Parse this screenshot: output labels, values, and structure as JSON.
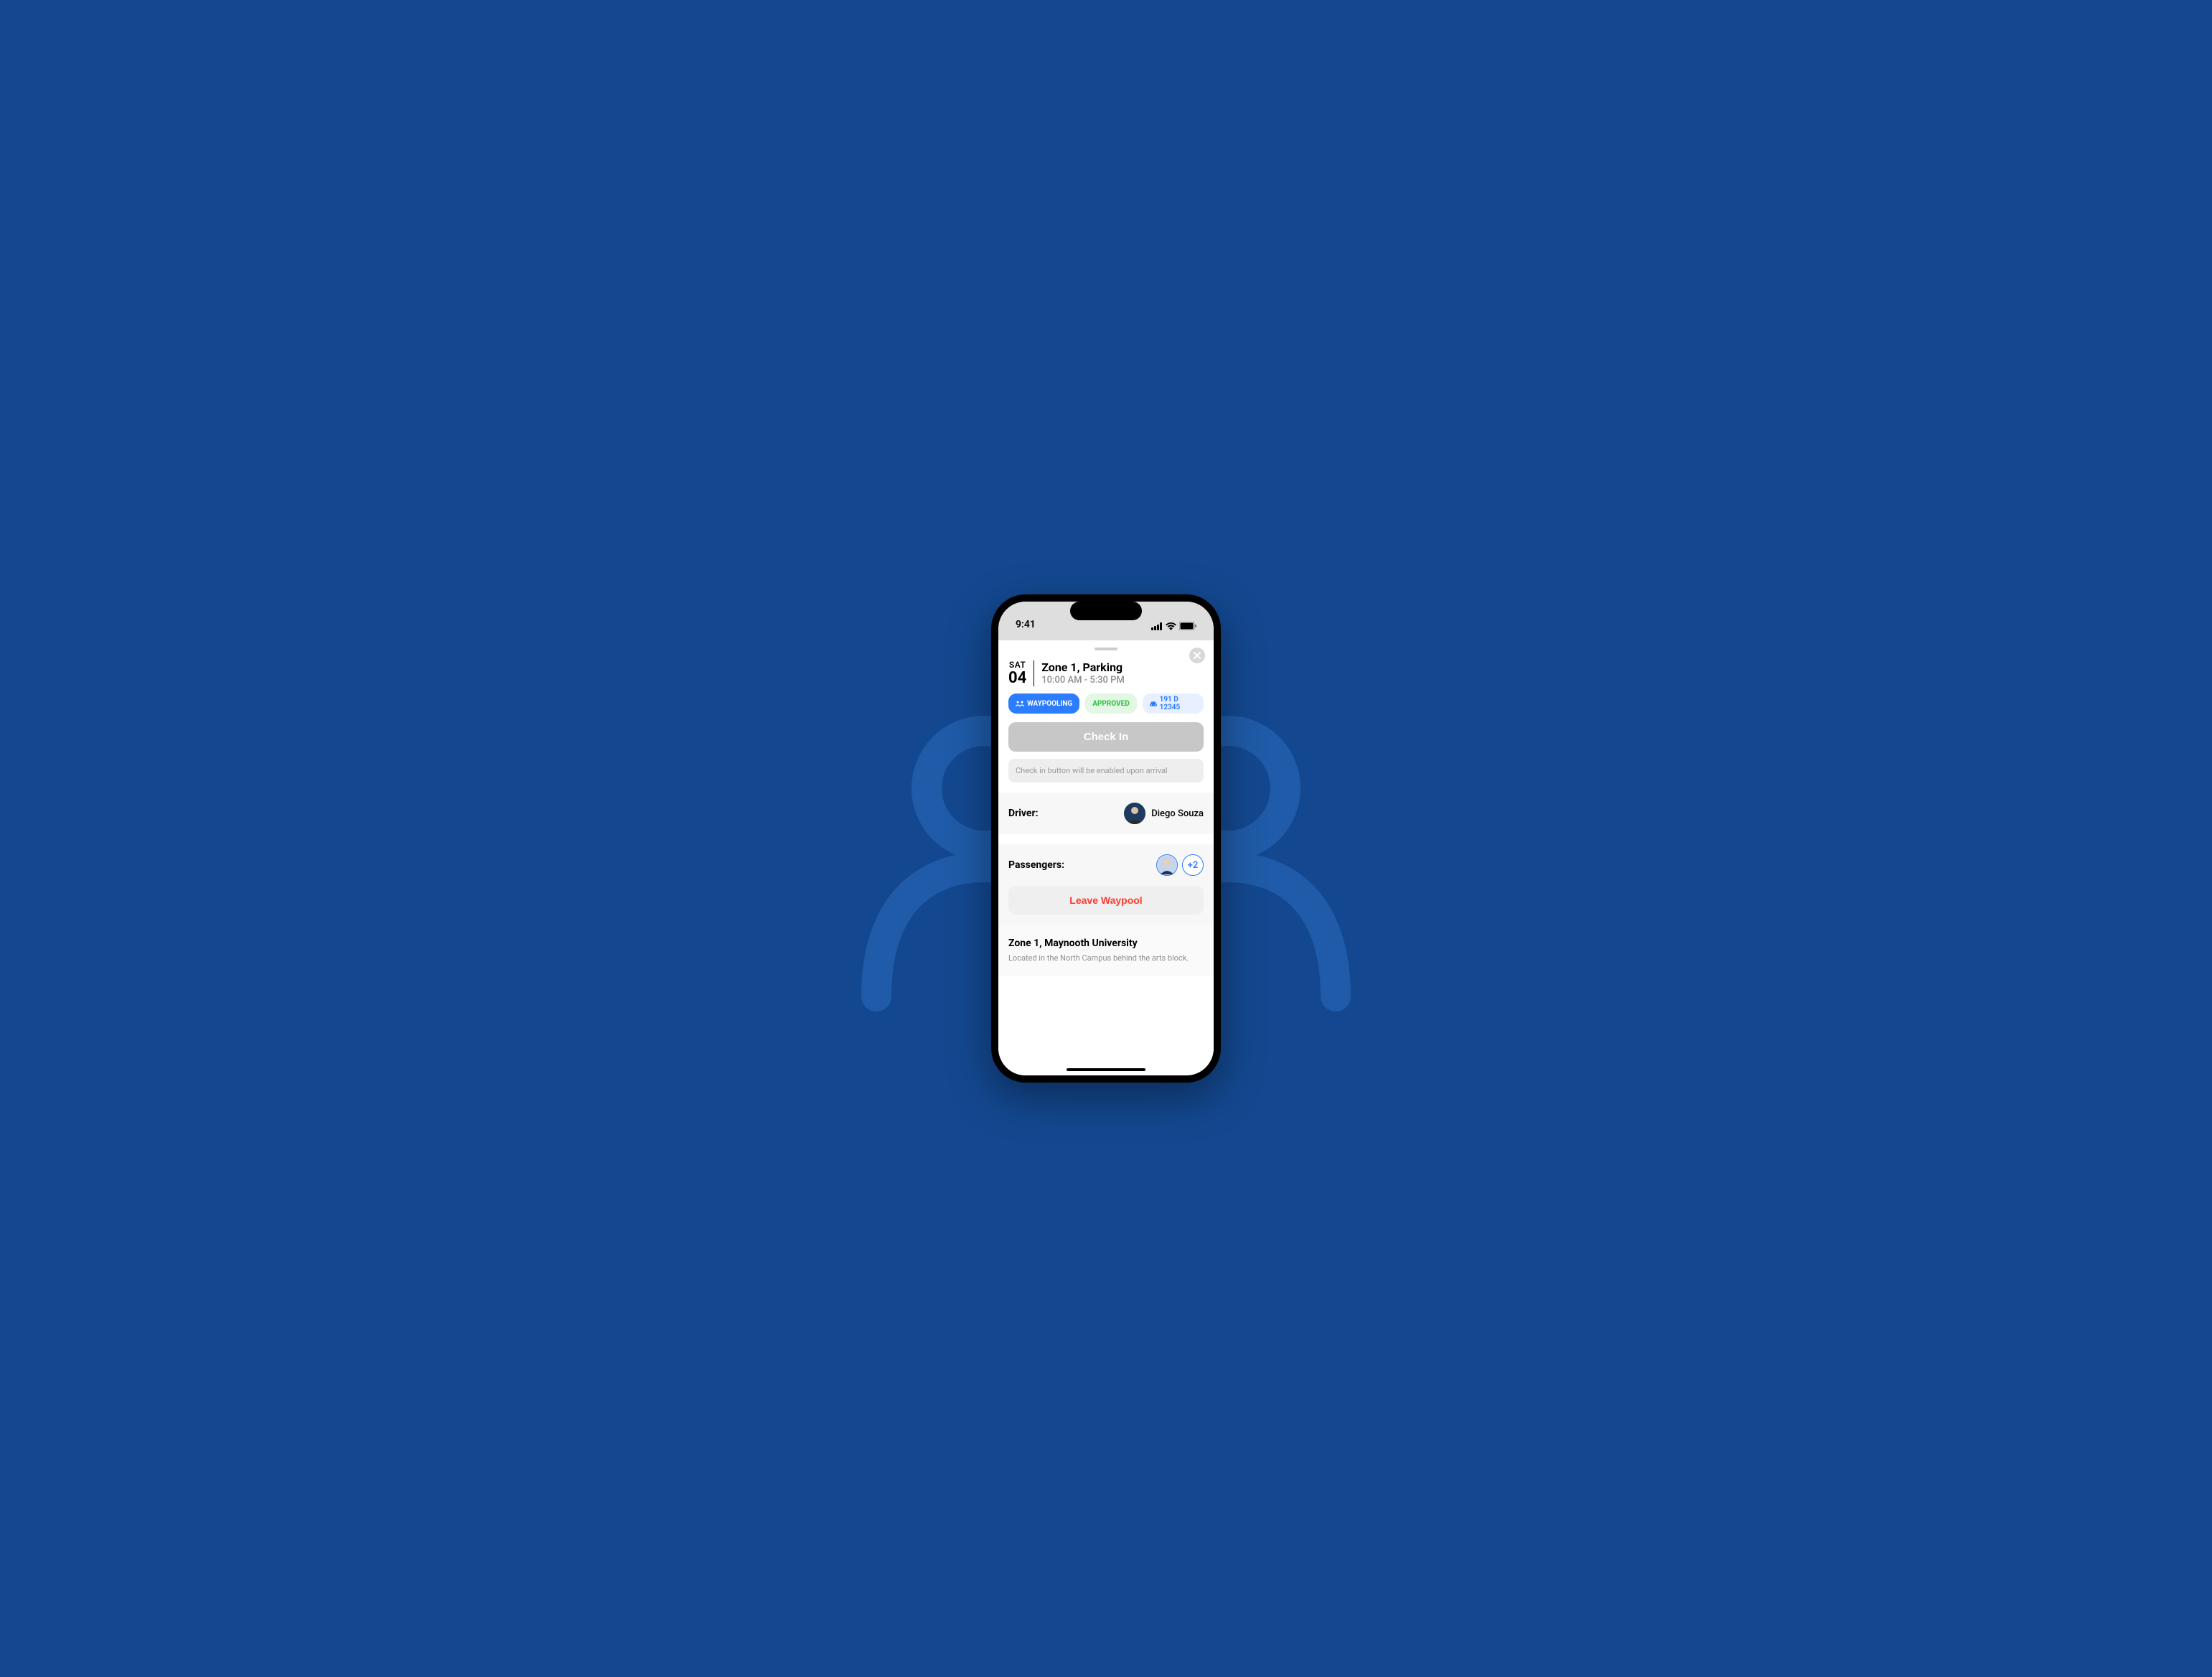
{
  "status": {
    "time": "9:41"
  },
  "sheet": {
    "date": {
      "dow": "SAT",
      "dom": "04"
    },
    "title": "Zone 1, Parking",
    "subtitle": "10:00 AM - 5:30 PM",
    "pills": {
      "waypooling": "WAYPOOLING",
      "approved": "APPROVED",
      "plate": "191 D 12345"
    },
    "checkin": {
      "button_label": "Check In",
      "hint": "Check in button will be enabled upon arrival"
    },
    "driver": {
      "label": "Driver:",
      "name": "Diego Souza"
    },
    "passengers": {
      "label": "Passengers:",
      "extra": "+2"
    },
    "leave_label": "Leave Waypool",
    "location": {
      "title": "Zone 1, Maynooth University",
      "desc": "Located in the North Campus behind the arts block."
    }
  }
}
